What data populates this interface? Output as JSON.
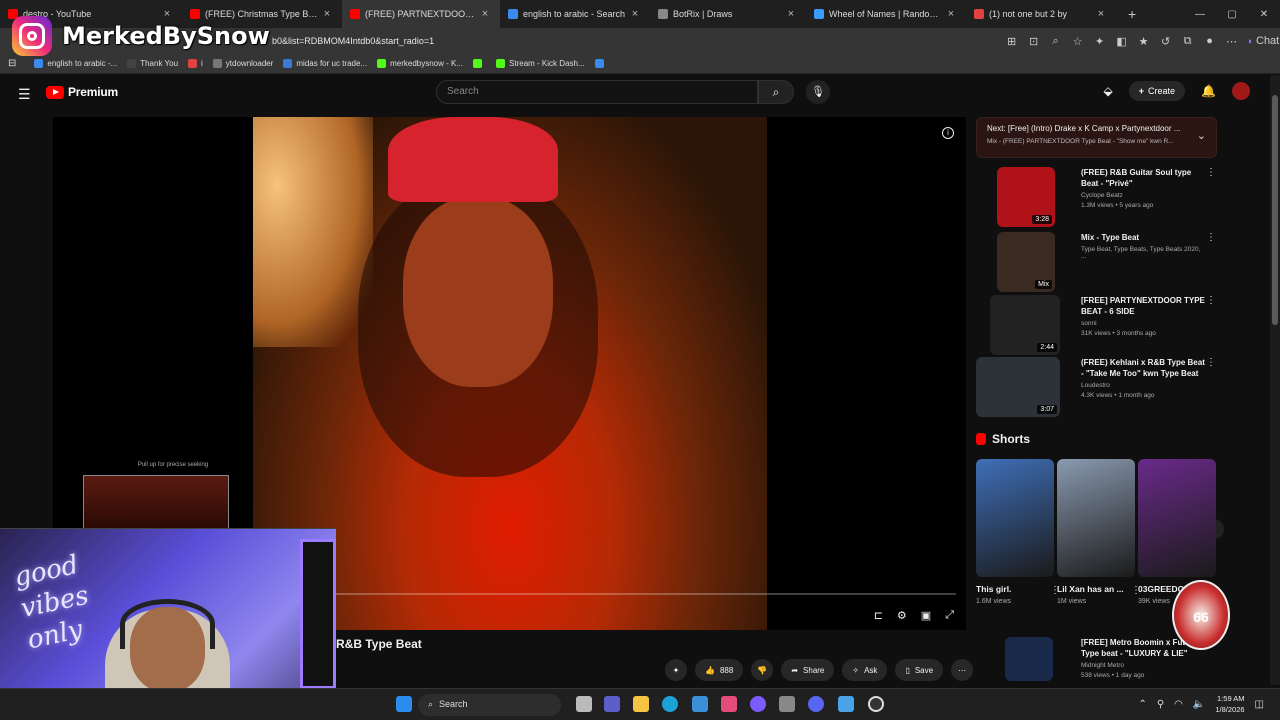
{
  "tabs": [
    {
      "title": "destro - YouTube",
      "fav": "#ff0000"
    },
    {
      "title": "(FREE) Christmas Type Beat R&B",
      "fav": "#ff0000"
    },
    {
      "title": "(FREE) PARTNEXTDOOR Type",
      "fav": "#ff0000",
      "active": true
    },
    {
      "title": "english to arabic - Search",
      "fav": "#3b8af0"
    },
    {
      "title": "BotRix | Draws",
      "fav": "#888888"
    },
    {
      "title": "Wheel of Names | Random name",
      "fav": "#3a9bff"
    },
    {
      "title": "(1) not one but 2 by",
      "fav": "#e14343"
    }
  ],
  "new_tab": "+",
  "window_controls": {
    "min": "—",
    "max": "▢",
    "close": "✕"
  },
  "url": "b0&list=RDBMOM4Intdb0&start_radio=1",
  "browser_chat": "Chat",
  "bookmarks": [
    {
      "label": "english to arabic -...",
      "color": "#3b8af0"
    },
    {
      "label": "Thank You",
      "color": "#444"
    },
    {
      "label": "i",
      "color": "#e14343"
    },
    {
      "label": "ytdownloader",
      "color": "#777"
    },
    {
      "label": "midas for uc trade...",
      "color": "#3a7bd5"
    },
    {
      "label": "merkedbysnow - K...",
      "color": "#53fc18"
    },
    {
      "label": "",
      "color": "#53fc18"
    },
    {
      "label": "Stream - Kick Dash...",
      "color": "#53fc18"
    },
    {
      "label": "",
      "color": "#3b8af0"
    }
  ],
  "overlay": {
    "name": "MerkedBySnow"
  },
  "youtube": {
    "logo_text": "Premium",
    "search_placeholder": "Search",
    "create_label": "Create",
    "video_title": "R&B Type Beat",
    "pull_up": "Pull up for precise seeking",
    "actions": {
      "likes": "888",
      "share": "Share",
      "ask": "Ask",
      "save": "Save"
    },
    "next": {
      "line1": "Next: [Free] (Intro) Drake x K Camp x Partynextdoor ...",
      "line2": "Mix - (FREE) PARTNEXTDOOR Type Beat - \"Show me\" kwn R..."
    },
    "recs": [
      {
        "title": "(FREE) R&B Guitar Soul type Beat - \"Privé\"",
        "channel": "Cyclope Beatz",
        "meta": "1.3M views • 5 years ago",
        "dur": "3:28",
        "color": "#b0121a"
      },
      {
        "title": "Mix - Type Beat",
        "channel": "Type Beat, Type Beats, Type Beats 2020, ...",
        "meta": "",
        "dur": "Mix",
        "color": "#3a2a22"
      },
      {
        "title": "[FREE] PARTYNEXTDOOR TYPE BEAT - 6 SIDE",
        "channel": "sonni",
        "meta": "31K views • 3 months ago",
        "dur": "2:44",
        "color": "#222"
      },
      {
        "title": "(FREE) Kehlani x R&B Type Beat - \"Take Me Too\" kwn Type Beat",
        "channel": "Loudestro",
        "meta": "4.3K views • 1 month ago",
        "dur": "3:07",
        "color": "#2c3238"
      },
      {
        "title": "[FREE] Metro Boomin x Future Type beat - \"LUXURY & LIE\"",
        "channel": "Midnight Metro",
        "meta": "538 views • 1 day ago",
        "dur": "",
        "color": "#1a2a4a"
      }
    ],
    "shorts_label": "Shorts",
    "shorts": [
      {
        "title": "This girl.",
        "views": "1.6M views",
        "color": "#3f6fb8"
      },
      {
        "title": "Lil Xan has an ...",
        "views": "1M views",
        "color": "#8a9ab0"
      },
      {
        "title": "03GREEDO Almost L...",
        "views": "39K views",
        "color": "#6a2a8a"
      }
    ]
  },
  "webcam": {
    "sign": "good vibes only",
    "badge": "66"
  },
  "taskbar": {
    "search": "Search",
    "time": "1:59 AM",
    "date": "1/8/2026"
  }
}
